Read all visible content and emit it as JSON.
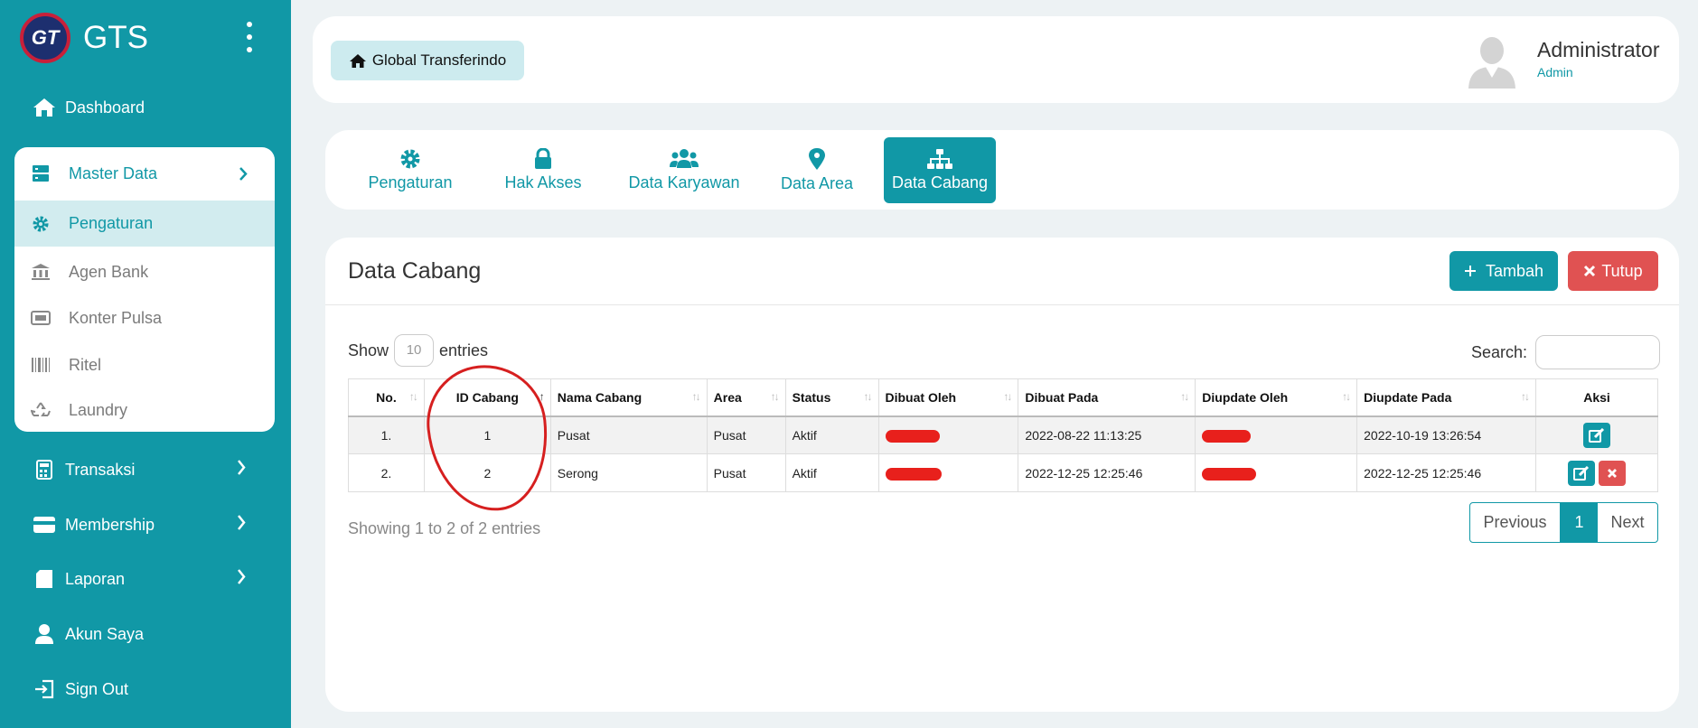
{
  "sidebar": {
    "brand": "GTS",
    "logo_text": "GT",
    "nav": {
      "dashboard": "Dashboard",
      "transaksi": "Transaksi",
      "membership": "Membership",
      "laporan": "Laporan",
      "akun_saya": "Akun Saya",
      "sign_out": "Sign Out"
    },
    "master": {
      "head": "Master Data",
      "items": [
        "Pengaturan",
        "Agen Bank",
        "Konter Pulsa",
        "Ritel",
        "Laundry"
      ]
    }
  },
  "header": {
    "company": "Global Transferindo",
    "user_name": "Administrator",
    "user_role": "Admin"
  },
  "tabs": [
    "Pengaturan",
    "Hak Akses",
    "Data Karyawan",
    "Data Area",
    "Data Cabang"
  ],
  "active_tab": "Data Cabang",
  "main": {
    "title": "Data Cabang",
    "add_label": "Tambah",
    "close_label": "Tutup",
    "show_label": "Show",
    "entries_label": "entries",
    "page_length": "10",
    "search_label": "Search:",
    "search_value": "",
    "info": "Showing 1 to 2 of 2 entries",
    "pager": {
      "prev": "Previous",
      "current": "1",
      "next": "Next"
    }
  },
  "table": {
    "columns": [
      "No.",
      "ID Cabang",
      "Nama Cabang",
      "Area",
      "Status",
      "Dibuat Oleh",
      "Dibuat Pada",
      "Diupdate Oleh",
      "Diupdate Pada",
      "Aksi"
    ],
    "rows": [
      {
        "no": "1.",
        "id": "1",
        "nama": "Pusat",
        "area": "Pusat",
        "status": "Aktif",
        "dibuat_pada": "2022-08-22 11:13:25",
        "diupdate_pada": "2022-10-19 13:26:54"
      },
      {
        "no": "2.",
        "id": "2",
        "nama": "Serong",
        "area": "Pusat",
        "status": "Aktif",
        "dibuat_pada": "2022-12-25 12:25:46",
        "diupdate_pada": "2022-12-25 12:25:46"
      }
    ]
  },
  "colors": {
    "primary": "#1198a6",
    "danger": "#e05252",
    "redaction": "#e8201c",
    "background": "#edf2f4"
  }
}
